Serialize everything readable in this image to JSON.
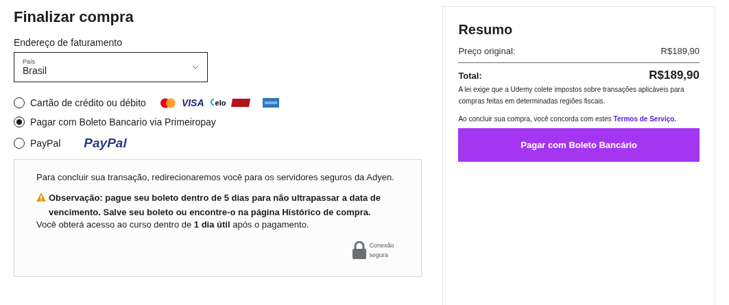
{
  "title": "Finalizar compra",
  "billing": {
    "label": "Endereço de faturamento",
    "country_field": {
      "label": "País",
      "value": "Brasil"
    }
  },
  "payment_methods": [
    {
      "label": "Cartão de crédito ou débito",
      "selected": false,
      "logos": [
        {
          "kind": "mastercard"
        },
        {
          "kind": "visa",
          "text": "VISA"
        },
        {
          "kind": "elo",
          "text": "elo"
        },
        {
          "kind": "hipercard"
        },
        {
          "kind": "amex"
        }
      ]
    },
    {
      "label": "Pagar com Boleto Bancario via Primeiropay",
      "selected": true
    },
    {
      "label": "PayPal",
      "selected": false,
      "logos": [
        {
          "kind": "paypal",
          "text": "PayPal"
        }
      ]
    }
  ],
  "notice": {
    "redirect": "Para concluir sua transação, redirecionaremos você para os servidores seguros da Adyen.",
    "warning": "Observação: pague seu boleto dentro de 5 dias para não ultrapassar a data de vencimento. Salve seu boleto ou encontre-o na página Histórico de compra.",
    "access": "Você obterá acesso ao curso dentro de **1 dia útil** após o pagamento.",
    "secure": "Conexão segura"
  },
  "summary": {
    "title": "Resumo",
    "original_label": "Preço original:",
    "original_value": "R$189,90",
    "total_label": "Total:",
    "total_value": "R$189,90",
    "tax_note": "A lei exige que a Udemy colete impostos sobre transações aplicáveis para compras feitas em determinadas regiões fiscais.",
    "terms_text": "Ao concluir sua compra, você concorda com estes",
    "terms_link": "Termos de Serviço.",
    "pay_button": "Pagar com Boleto Bancário"
  }
}
